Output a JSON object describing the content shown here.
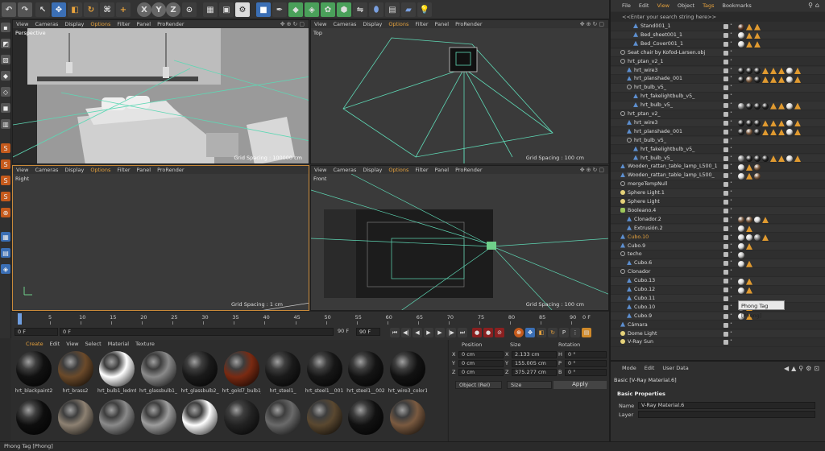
{
  "viewports": {
    "menu": [
      "View",
      "Cameras",
      "Display",
      "Options",
      "Filter",
      "Panel",
      "ProRender"
    ],
    "perspective": {
      "name": "Perspective",
      "grid": "Grid Spacing : 100000 cm"
    },
    "top": {
      "name": "Top",
      "grid": "Grid Spacing : 100 cm"
    },
    "right": {
      "name": "Right",
      "grid": "Grid Spacing : 1 cm"
    },
    "front": {
      "name": "Front",
      "grid": "Grid Spacing : 100 cm"
    }
  },
  "timeline": {
    "ticks": [
      "0",
      "5",
      "10",
      "15",
      "20",
      "25",
      "30",
      "35",
      "40",
      "45",
      "50",
      "55",
      "60",
      "65",
      "70",
      "75",
      "80",
      "85",
      "90"
    ],
    "end_frame": "0 F",
    "start_field": "0 F",
    "current_field": "0 F",
    "max_field": "90 F",
    "max_field2": "90 F"
  },
  "material_manager": {
    "menu": [
      "Create",
      "Edit",
      "View",
      "Select",
      "Material",
      "Texture"
    ],
    "row1": [
      {
        "label": "hrt_blackpaint2",
        "color": "#111111"
      },
      {
        "label": "hrt_brass2",
        "color": "#6b4a2a"
      },
      {
        "label": "hrt_bulb1_ledmtl",
        "color": "#ffffff"
      },
      {
        "label": "hrt_glassbulb1_",
        "color": "#8a8a8a"
      },
      {
        "label": "hrt_glassbulb2_",
        "color": "#1a1a1a"
      },
      {
        "label": "hrt_gold7_bulb1_",
        "color": "#7a2a12"
      },
      {
        "label": "hrt_steel1_",
        "color": "#1a1a1a"
      },
      {
        "label": "hrt_steel1__001",
        "color": "#161616"
      },
      {
        "label": "hrt_steel1__002",
        "color": "#141414"
      },
      {
        "label": "hrt_wire3_color1",
        "color": "#121212"
      }
    ],
    "row2_colors": [
      "#0e0e0e",
      "#8d8172",
      "#8a8a8a",
      "#9d9d9d",
      "#ffffff",
      "#222222",
      "#6a6a6a",
      "#5a4830",
      "#111111",
      "#7a5a40"
    ]
  },
  "coordinates": {
    "headers": {
      "position": "Position",
      "size": "Size",
      "rotation": "Rotation"
    },
    "rows": [
      {
        "axis": "X",
        "pos": "0 cm",
        "size_axis": "X",
        "size": "2.133 cm",
        "rot_axis": "H",
        "rot": "0 °"
      },
      {
        "axis": "Y",
        "pos": "0 cm",
        "size_axis": "Y",
        "size": "155.005 cm",
        "rot_axis": "P",
        "rot": "0 °"
      },
      {
        "axis": "Z",
        "pos": "0 cm",
        "size_axis": "Z",
        "size": "375.277 cm",
        "rot_axis": "B",
        "rot": "0 °"
      }
    ],
    "mode": "Object (Rel)",
    "size_mode": "Size",
    "apply": "Apply"
  },
  "object_manager": {
    "menu": [
      "File",
      "Edit",
      "View",
      "Object",
      "Tags",
      "Bookmarks"
    ],
    "search": "<<Enter your search string here>>",
    "rows": [
      {
        "name": "Stand001_1",
        "indent": 3,
        "icon": "obj",
        "tags": [
          "#5a3a2a",
          "tri",
          "tri"
        ]
      },
      {
        "name": "Bed_sheet001_1",
        "indent": 3,
        "icon": "obj",
        "tags": [
          "#d8d8d8",
          "tri",
          "tri"
        ]
      },
      {
        "name": "Bed_Cover001_1",
        "indent": 3,
        "icon": "obj",
        "tags": [
          "#d8d8d8",
          "tri",
          "tri"
        ]
      },
      {
        "name": "Seat chair by Kofod-Larsen.obj",
        "indent": 1,
        "icon": "null",
        "tags": []
      },
      {
        "name": "hrt_ptan_v2_1",
        "indent": 1,
        "icon": "null",
        "tags": []
      },
      {
        "name": "hrt_wire3",
        "indent": 2,
        "icon": "obj",
        "tags": [
          "#222222",
          "#222222",
          "#222222",
          "tri",
          "tri",
          "tri",
          "#d8d8d8",
          "tri"
        ]
      },
      {
        "name": "hrt_planshade_001",
        "indent": 2,
        "icon": "obj",
        "tags": [
          "#222222",
          "#7a5a40",
          "#222222",
          "tri",
          "tri",
          "tri",
          "#d8d8d8",
          "tri"
        ]
      },
      {
        "name": "hrt_bulb_v5_",
        "indent": 2,
        "icon": "null",
        "tags": []
      },
      {
        "name": "hrt_fakelightbulb_v5_",
        "indent": 3,
        "icon": "obj",
        "tags": []
      },
      {
        "name": "hrt_bulb_v5_",
        "indent": 3,
        "icon": "obj",
        "tags": [
          "#8a8a8a",
          "#222222",
          "#222222",
          "#222222",
          "tri",
          "tri",
          "#d8d8d8",
          "tri"
        ]
      },
      {
        "name": "hrt_ptan_v2_",
        "indent": 1,
        "icon": "null",
        "tags": []
      },
      {
        "name": "hrt_wire3",
        "indent": 2,
        "icon": "obj",
        "tags": [
          "#222222",
          "#222222",
          "#222222",
          "tri",
          "tri",
          "tri",
          "#d8d8d8",
          "tri"
        ]
      },
      {
        "name": "hrt_planshade_001",
        "indent": 2,
        "icon": "obj",
        "tags": [
          "#222222",
          "#7a5a40",
          "#222222",
          "tri",
          "tri",
          "tri",
          "#d8d8d8",
          "tri"
        ]
      },
      {
        "name": "hrt_bulb_v5_",
        "indent": 2,
        "icon": "null",
        "tags": []
      },
      {
        "name": "hrt_fakelightbulb_v5_",
        "indent": 3,
        "icon": "obj",
        "tags": []
      },
      {
        "name": "hrt_bulb_v5_",
        "indent": 3,
        "icon": "obj",
        "tags": [
          "#8a8a8a",
          "#222222",
          "#222222",
          "#222222",
          "tri",
          "tri",
          "#d8d8d8",
          "tri"
        ]
      },
      {
        "name": "Wooden_rattan_table_lamp_L500_1",
        "indent": 1,
        "icon": "obj",
        "tags": [
          "#d8d8d8",
          "tri",
          "#7a5a40"
        ]
      },
      {
        "name": "Wooden_rattan_table_lamp_L500_",
        "indent": 1,
        "icon": "obj",
        "tags": [
          "#d8d8d8",
          "tri",
          "#7a5a40"
        ]
      },
      {
        "name": "mergeTempNull",
        "indent": 1,
        "icon": "null",
        "tags": []
      },
      {
        "name": "Sphere Light.1",
        "indent": 1,
        "icon": "light",
        "tags": []
      },
      {
        "name": "Sphere Light",
        "indent": 1,
        "icon": "light",
        "tags": []
      },
      {
        "name": "Booleano.4",
        "indent": 1,
        "icon": "bool",
        "tags": []
      },
      {
        "name": "Clonador.2",
        "indent": 2,
        "icon": "obj",
        "tags": [
          "#7a5a40",
          "#7a5a40",
          "#d8d8d8",
          "tri"
        ]
      },
      {
        "name": "Extrusión.2",
        "indent": 2,
        "icon": "obj",
        "tags": [
          "#d8d8d8",
          "tri"
        ]
      },
      {
        "name": "Cubo.10",
        "indent": 1,
        "icon": "obj",
        "orange": true,
        "tags": [
          "#d8d8d8",
          "#d8d8d8",
          "#8a8a8a",
          "tri"
        ]
      },
      {
        "name": "Cubo.9",
        "indent": 1,
        "icon": "obj",
        "tags": [
          "#d8d8d8",
          "tri"
        ]
      },
      {
        "name": "techo",
        "indent": 1,
        "icon": "null",
        "tags": [
          "#c0c0c0"
        ]
      },
      {
        "name": "Cubo.6",
        "indent": 2,
        "icon": "obj",
        "tags": [
          "#d8d8d8",
          "tri"
        ]
      },
      {
        "name": "Clonador",
        "indent": 1,
        "icon": "null",
        "tags": []
      },
      {
        "name": "Cubo.13",
        "indent": 2,
        "icon": "obj",
        "tags": [
          "#d8d8d8",
          "tri"
        ]
      },
      {
        "name": "Cubo.12",
        "indent": 2,
        "icon": "obj",
        "tags": [
          "#d8d8d8",
          "tri"
        ]
      },
      {
        "name": "Cubo.11",
        "indent": 2,
        "icon": "obj",
        "tags": []
      },
      {
        "name": "Cubo.10",
        "indent": 2,
        "icon": "obj",
        "tags": [
          "#d8d8d8",
          "tri"
        ]
      },
      {
        "name": "Cubo.9",
        "indent": 2,
        "icon": "obj",
        "tags": [
          "#d8d8d8",
          "tri"
        ]
      },
      {
        "name": "Cámara",
        "indent": 1,
        "icon": "obj",
        "tags": []
      },
      {
        "name": "Dome Light",
        "indent": 1,
        "icon": "light",
        "tags": []
      },
      {
        "name": "V-Ray Sun",
        "indent": 1,
        "icon": "light",
        "tags": []
      }
    ],
    "tooltip": "Phong Tag [Phong]"
  },
  "attributes": {
    "menu": [
      "Mode",
      "Edit",
      "User Data"
    ],
    "title": "Basic [V-Ray Material.6]",
    "section": "Basic Properties",
    "name_label": "Name",
    "name_value": "V-Ray Material.6",
    "layer_label": "Layer",
    "layer_value": ""
  },
  "status": "Phong Tag [Phong]"
}
